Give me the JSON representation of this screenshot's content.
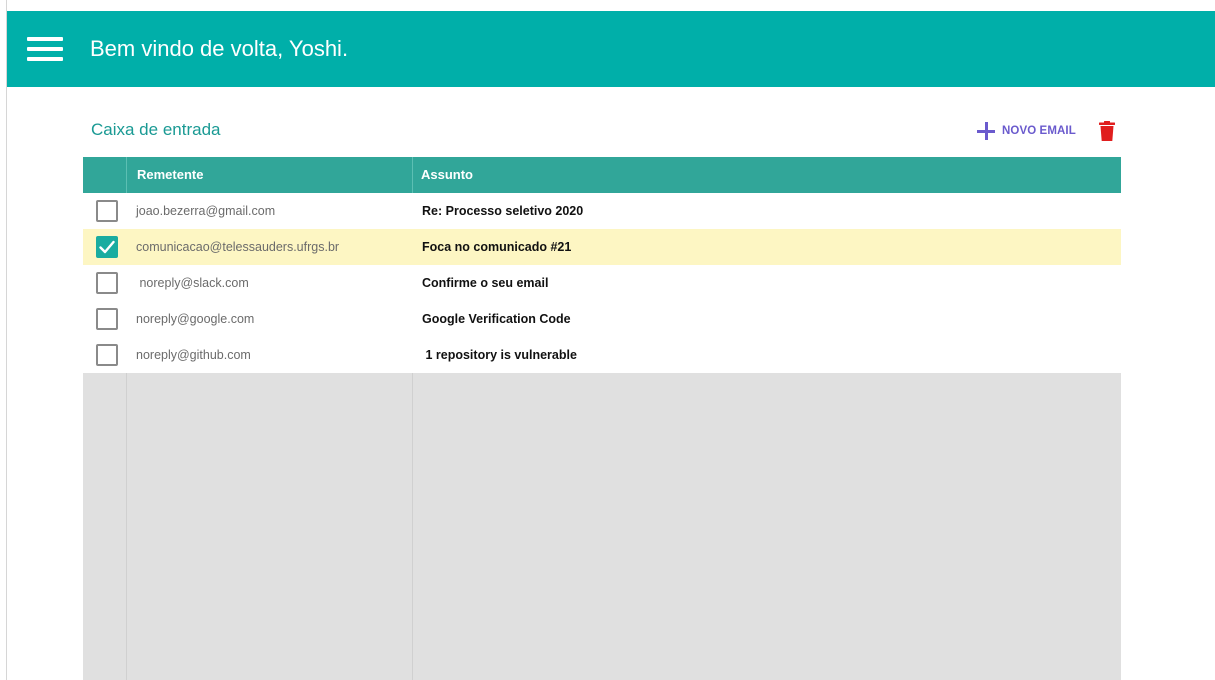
{
  "header": {
    "welcome": "Bem vindo de volta, Yoshi."
  },
  "inbox": {
    "title": "Caixa de entrada",
    "new_email_label": "NOVO EMAIL"
  },
  "table": {
    "columns": [
      "Remetente",
      "Assunto"
    ],
    "rows": [
      {
        "sender": "joao.bezerra@gmail.com",
        "subject": "Re: Processo seletivo 2020",
        "checked": false
      },
      {
        "sender": "comunicacao@telessauders.ufrgs.br",
        "subject": "Foca no comunicado #21",
        "checked": true
      },
      {
        "sender": " noreply@slack.com",
        "subject": "Confirme o seu email",
        "checked": false
      },
      {
        "sender": "noreply@google.com",
        "subject": "Google Verification Code",
        "checked": false
      },
      {
        "sender": "noreply@github.com",
        "subject": " 1 repository is vulnerable",
        "checked": false
      }
    ]
  },
  "icons": {
    "menu": "menu-icon",
    "add": "plus-icon",
    "delete": "trash-icon",
    "check": "check-icon"
  },
  "colors": {
    "header_bg": "#00afa9",
    "table_header_bg": "#31a699",
    "selected_row_bg": "#fdf6c3",
    "accent_purple": "#6a5acd",
    "danger_red": "#e01e1e",
    "checkbox_checked": "#19aca0"
  }
}
